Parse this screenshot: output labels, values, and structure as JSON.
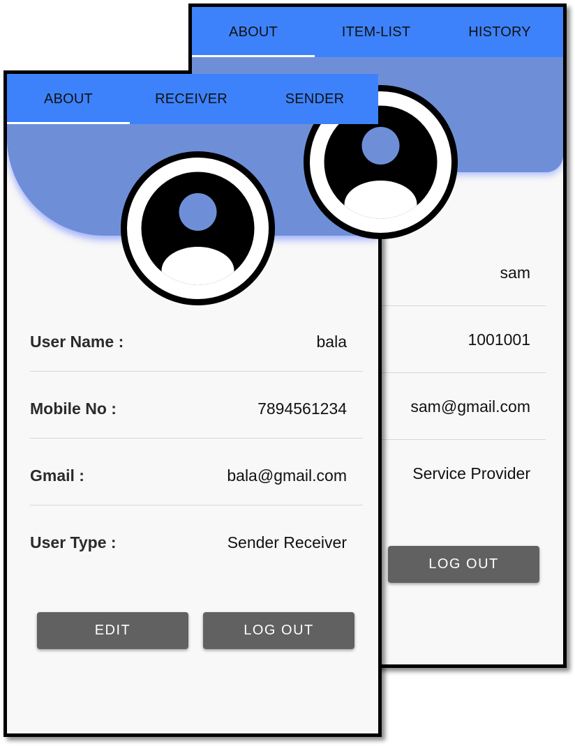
{
  "back_screen": {
    "tabs": [
      {
        "label": "ABOUT"
      },
      {
        "label": "ITEM-LIST"
      },
      {
        "label": "HISTORY"
      }
    ],
    "active_tab": "ABOUT",
    "profile_values": {
      "user_name": "sam",
      "mobile_no": "1001001",
      "gmail": "sam@gmail.com",
      "user_type": "Service Provider"
    },
    "logout_label": "LOG OUT"
  },
  "front_screen": {
    "tabs": [
      {
        "label": "ABOUT"
      },
      {
        "label": "RECEIVER"
      },
      {
        "label": "SENDER"
      }
    ],
    "active_tab": "ABOUT",
    "rows": [
      {
        "label": "User Name :",
        "value": "bala"
      },
      {
        "label": "Mobile No :",
        "value": "7894561234"
      },
      {
        "label": "Gmail :",
        "value": "bala@gmail.com"
      },
      {
        "label": "User Type :",
        "value": "Sender Receiver"
      }
    ],
    "edit_label": "EDIT",
    "logout_label": "LOG OUT"
  },
  "colors": {
    "tab_bar": "#3d82fa",
    "hero": "#6e8fd8",
    "button": "#616161",
    "background": "#f8f8f8"
  },
  "icons": {
    "avatar": "account-circle-icon"
  }
}
